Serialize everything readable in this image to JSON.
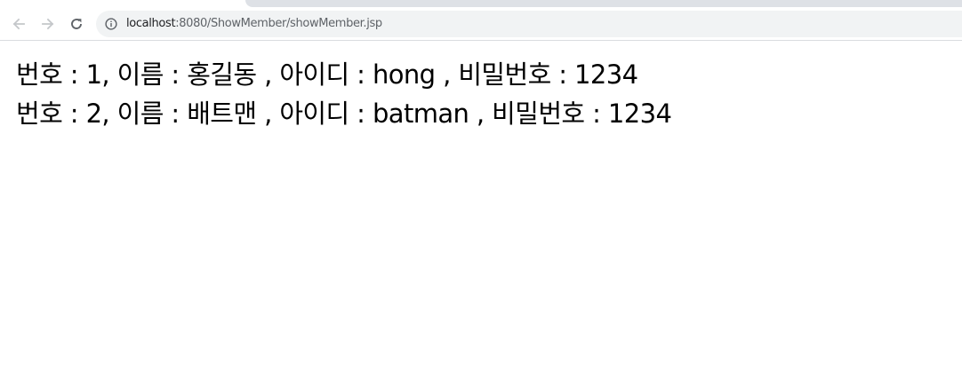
{
  "browser": {
    "address": {
      "host": "localhost",
      "path": ":8080/ShowMember/showMember.jsp"
    },
    "icons": {
      "back": "arrow-left-icon",
      "forward": "arrow-right-icon",
      "reload": "reload-icon",
      "site_info": "info-circle-icon"
    }
  },
  "members": [
    {
      "text": "번호 : 1, 이름 : 홍길동 , 아이디 : hong , 비밀번호 : 1234"
    },
    {
      "text": "번호 : 2, 이름 : 배트맨 , 아이디 : batman , 비밀번호 : 1234"
    }
  ]
}
